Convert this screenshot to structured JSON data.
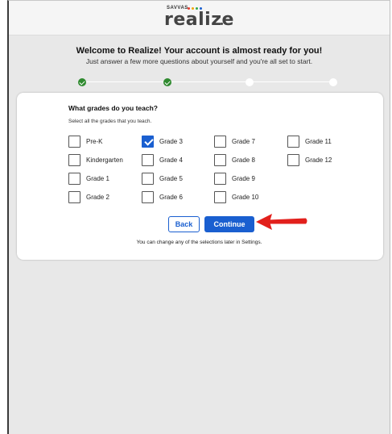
{
  "brand": {
    "small": "SAVVAS",
    "name": "realize",
    "dot_colors": [
      "#e63a2e",
      "#f0a500",
      "#2fa84f",
      "#1a5fd0"
    ]
  },
  "intro": {
    "title": "Welcome to Realize! Your account is almost ready for you!",
    "subtitle": "Just answer a few more questions about yourself and you're all set to start."
  },
  "progress": {
    "total_steps": 4,
    "completed_steps": 2
  },
  "form": {
    "question": "What grades do you teach?",
    "hint": "Select all the grades that you teach.",
    "options": [
      {
        "label": "Pre-K",
        "checked": false
      },
      {
        "label": "Kindergarten",
        "checked": false
      },
      {
        "label": "Grade 1",
        "checked": false
      },
      {
        "label": "Grade 2",
        "checked": false
      },
      {
        "label": "Grade 3",
        "checked": true
      },
      {
        "label": "Grade 4",
        "checked": false
      },
      {
        "label": "Grade 5",
        "checked": false
      },
      {
        "label": "Grade 6",
        "checked": false
      },
      {
        "label": "Grade 7",
        "checked": false
      },
      {
        "label": "Grade 8",
        "checked": false
      },
      {
        "label": "Grade 9",
        "checked": false
      },
      {
        "label": "Grade 10",
        "checked": false
      },
      {
        "label": "Grade 11",
        "checked": false
      },
      {
        "label": "Grade 12",
        "checked": false
      }
    ],
    "back_label": "Back",
    "continue_label": "Continue",
    "note": "You can change any of the selections later in Settings."
  },
  "colors": {
    "accent": "#1a5fd0",
    "done": "#2f8a2f",
    "arrow": "#e2201c"
  }
}
